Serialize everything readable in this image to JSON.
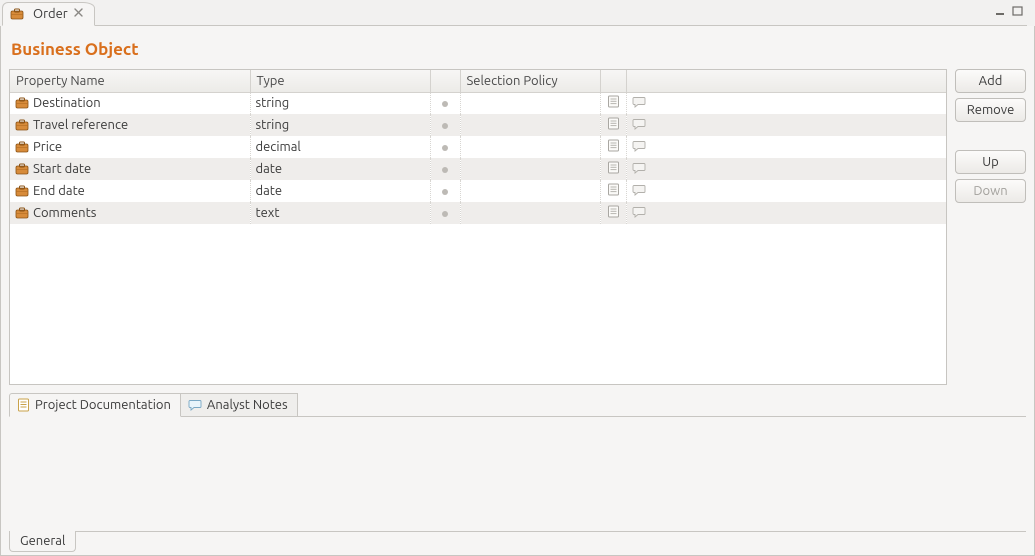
{
  "tab": {
    "title": "Order"
  },
  "page_title": "Business Object",
  "columns": {
    "name": "Property Name",
    "type": "Type",
    "selection": "Selection Policy"
  },
  "rows": [
    {
      "name": "Destination",
      "type": "string"
    },
    {
      "name": "Travel reference",
      "type": "string"
    },
    {
      "name": "Price",
      "type": "decimal"
    },
    {
      "name": "Start date",
      "type": "date"
    },
    {
      "name": "End date",
      "type": "date"
    },
    {
      "name": "Comments",
      "type": "text"
    }
  ],
  "buttons": {
    "add": "Add",
    "remove": "Remove",
    "up": "Up",
    "down": "Down"
  },
  "doc_tabs": {
    "project": "Project Documentation",
    "analyst": "Analyst Notes"
  },
  "bottom_tab": "General"
}
